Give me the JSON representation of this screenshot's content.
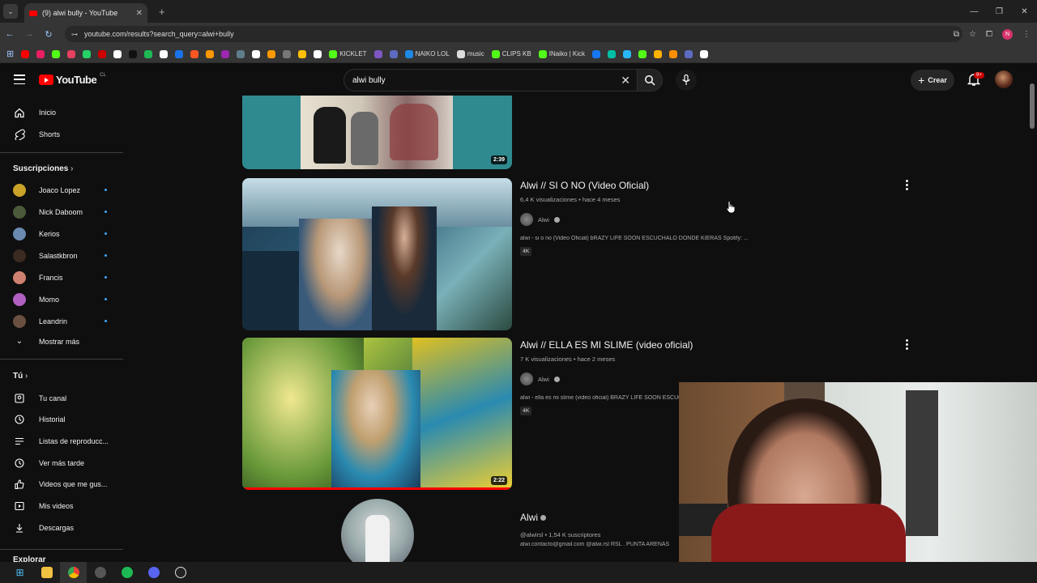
{
  "browser": {
    "tab_title": "(9) alwi bully - YouTube",
    "tab_close": "✕",
    "new_tab": "+",
    "url": "youtube.com/results?search_query=alwi+bully",
    "bookmarks": [
      {
        "label": "",
        "color": "#ff0000"
      },
      {
        "label": "",
        "color": "#e91e63"
      },
      {
        "label": "",
        "color": "#53fc18"
      },
      {
        "label": "",
        "color": "#e4405f"
      },
      {
        "label": "",
        "color": "#25d366"
      },
      {
        "label": "",
        "color": "#cc0000"
      },
      {
        "label": "",
        "color": "#ffffff"
      },
      {
        "label": "",
        "color": "#111111"
      },
      {
        "label": "",
        "color": "#1db954"
      },
      {
        "label": "",
        "color": "#ffffff"
      },
      {
        "label": "",
        "color": "#1a73e8"
      },
      {
        "label": "",
        "color": "#ff5722"
      },
      {
        "label": "",
        "color": "#ff9800"
      },
      {
        "label": "",
        "color": "#9c27b0"
      },
      {
        "label": "",
        "color": "#607d8b"
      },
      {
        "label": "",
        "color": "#ffffff"
      },
      {
        "label": "",
        "color": "#ff9900"
      },
      {
        "label": "",
        "color": "#777777"
      },
      {
        "label": "",
        "color": "#ffc107"
      },
      {
        "label": "",
        "color": "#ffffff"
      },
      {
        "label": "KICKLET",
        "color": "#53fc18"
      },
      {
        "label": "",
        "color": "#7e57c2"
      },
      {
        "label": "",
        "color": "#5c6bc0"
      },
      {
        "label": "NAIKO LOL",
        "color": "#1e88e5"
      },
      {
        "label": "music",
        "color": "#dddddd"
      },
      {
        "label": "CLIPS KB",
        "color": "#53fc18"
      },
      {
        "label": "INaiko | Kick",
        "color": "#53fc18"
      },
      {
        "label": "",
        "color": "#1877f2"
      },
      {
        "label": "",
        "color": "#00bfa5"
      },
      {
        "label": "",
        "color": "#29b6f6"
      },
      {
        "label": "",
        "color": "#53fc18"
      },
      {
        "label": "",
        "color": "#ffb300"
      },
      {
        "label": "",
        "color": "#ff8f00"
      },
      {
        "label": "",
        "color": "#5c6bc0"
      },
      {
        "label": "",
        "color": "#ffffff"
      }
    ]
  },
  "header": {
    "logo_text": "YouTube",
    "logo_country": "CL",
    "search_value": "alwi bully",
    "create_label": "Crear",
    "notif_badge": "9+"
  },
  "sidebar": {
    "main": [
      {
        "label": "Inicio",
        "icon": "home-icon"
      },
      {
        "label": "Shorts",
        "icon": "shorts-icon"
      }
    ],
    "subs_heading": "Suscripciones",
    "subs": [
      {
        "label": "Joaco Lopez",
        "color": "#c9a227"
      },
      {
        "label": "Nick Daboom",
        "color": "#4a5a3a"
      },
      {
        "label": "Kerios",
        "color": "#6a8ab0"
      },
      {
        "label": "Salastkbron",
        "color": "#3a2a20"
      },
      {
        "label": "Francis",
        "color": "#d08070"
      },
      {
        "label": "Momo",
        "color": "#b060c0"
      },
      {
        "label": "Leandrin",
        "color": "#6a5040"
      }
    ],
    "show_more": "Mostrar más",
    "you_heading": "Tú",
    "you": [
      {
        "label": "Tu canal",
        "icon": "channel-icon"
      },
      {
        "label": "Historial",
        "icon": "history-icon"
      },
      {
        "label": "Listas de reproducc...",
        "icon": "playlist-icon"
      },
      {
        "label": "Ver más tarde",
        "icon": "clock-icon"
      },
      {
        "label": "Videos que me gus...",
        "icon": "thumbs-up-icon"
      },
      {
        "label": "Mis videos",
        "icon": "my-videos-icon"
      },
      {
        "label": "Descargas",
        "icon": "download-icon"
      }
    ],
    "explore_heading": "Explorar"
  },
  "results": {
    "partial_video": {
      "duration": "2:39"
    },
    "videos": [
      {
        "title": "Alwi // SI O NO (Video Oficial)",
        "meta": "6,4 K visualizaciones • hace 4 meses",
        "channel": "Alwi",
        "desc": "alwi - si o no (Video Oficial) bRAZY LIFE SOON ESCUCHALO DONDE KIERAS Spotify: ...",
        "badge": "4K",
        "duration": ""
      },
      {
        "title": "Alwi // ELLA ES MI SLIME (video oficial)",
        "meta": "7 K visualizaciones • hace 2 meses",
        "channel": "Alwi",
        "desc": "alwi - ella es mi slime (video oficial) BRAZY LIFE SOON ESCUCHALO DONDE KIERAS",
        "badge": "4K",
        "duration": "2:22"
      }
    ],
    "channel_card": {
      "name": "Alwi",
      "meta": "@alwirsl • 1,54 K suscriptores",
      "desc": "alwi.contacto@gmail.com @alwi.rsl RSL . PUNTA ARENAS"
    }
  }
}
